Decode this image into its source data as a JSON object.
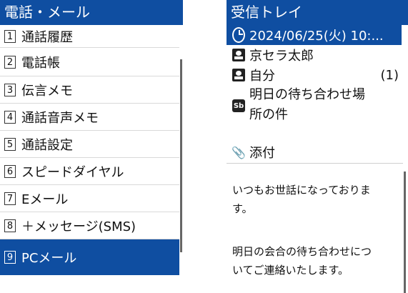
{
  "left": {
    "title": "電話・メール",
    "items": [
      {
        "num": "1",
        "label": "通話履歴"
      },
      {
        "num": "2",
        "label": "電話帳"
      },
      {
        "num": "3",
        "label": "伝言メモ"
      },
      {
        "num": "4",
        "label": "通話音声メモ"
      },
      {
        "num": "5",
        "label": "通話設定"
      },
      {
        "num": "6",
        "label": "スピードダイヤル"
      },
      {
        "num": "7",
        "label": "Eメール"
      },
      {
        "num": "8",
        "label": "＋メッセージ(SMS)"
      },
      {
        "num": "9",
        "label": "PCメール"
      }
    ],
    "selected_index": 8
  },
  "right": {
    "title": "受信トレイ",
    "date": "2024/06/25(火) 10:...",
    "sender": "京セラ太郎",
    "recipient": "自分",
    "recipient_count": "(1)",
    "subject_line1": "明日の待ち合わせ場",
    "subject_line2": "所の件",
    "attachment": "添付",
    "body_line1": "いつもお世話になっておりま",
    "body_line2": "す。",
    "body_line3": "明日の会合の待ち合わせにつ",
    "body_line4": "いてご連絡いたします。"
  },
  "colors": {
    "accent": "#0f4ea1"
  }
}
